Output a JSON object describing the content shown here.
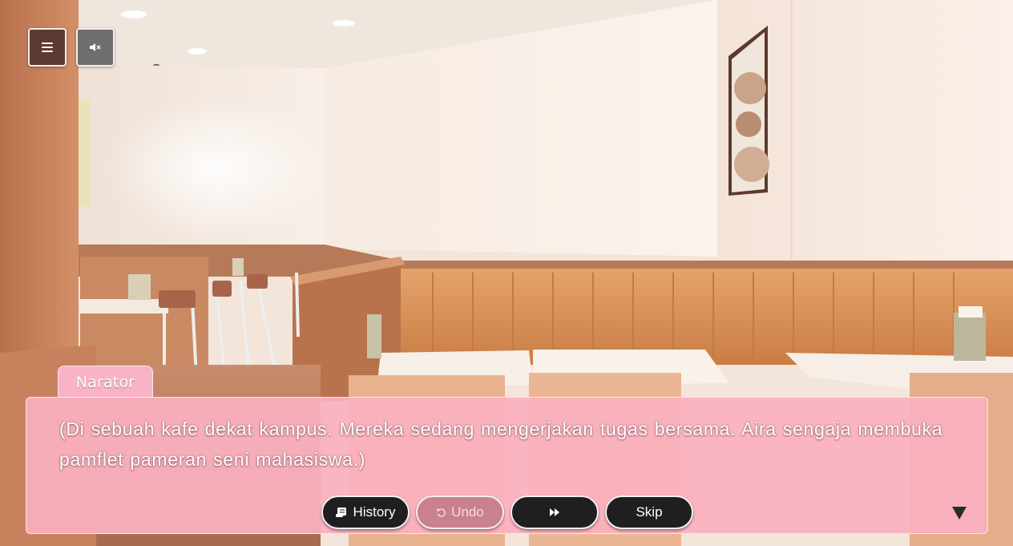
{
  "hud": {
    "menu_icon": "hamburger-menu-icon",
    "sound_icon": "speaker-muted-icon"
  },
  "dialogue": {
    "speaker": "Narator",
    "text": "(Di sebuah kafe dekat kampus. Mereka sedang mengerjakan tugas bersama. Aira sengaja membuka pamflet pameran seni mahasiswa.)"
  },
  "controls": {
    "history_label": "History",
    "undo_label": "Undo",
    "fast_forward_icon": "fast-forward-icon",
    "skip_label": "Skip",
    "next_icon": "triangle-down-icon"
  },
  "colors": {
    "dialog_bg": "#fab0c0",
    "name_tab": "#f8b4c6",
    "button_dark": "#1f1f21",
    "button_disabled": "#c9808f",
    "menu_button": "#5b3a30",
    "sound_button": "#6e6e70"
  }
}
